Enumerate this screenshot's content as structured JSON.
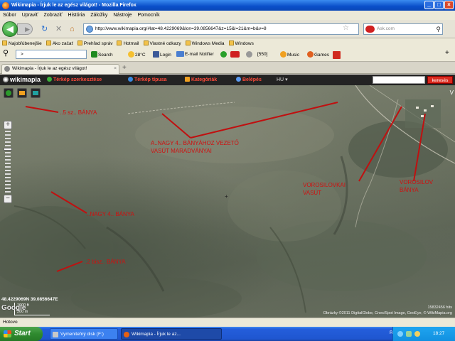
{
  "window": {
    "title": "Wikimapia - Írjuk le az egész világot! - Mozilla Firefox",
    "btn_min": "_",
    "btn_max": "□",
    "btn_close": "×"
  },
  "menu": [
    "Súbor",
    "Upraviť",
    "Zobraziť",
    "História",
    "Záložky",
    "Nástroje",
    "Pomocník"
  ],
  "nav": {
    "url": "http://www.wikimapia.org/#lat=48.4229069&lon=39.0856647&z=15&l=21&m=b&v=8",
    "search_placeholder": "Ask.com",
    "back_glyph": "◀",
    "forward_glyph": "▶",
    "reload_glyph": "↻",
    "stop_glyph": "✕",
    "home_glyph": "⌂",
    "star_glyph": "☆",
    "search_glyph": "⚲"
  },
  "bookmarks": [
    "Najobľúbenejšie",
    "Ako začať",
    "Prehľad správ",
    "Hotmail",
    "Vlastné odkazy",
    "Windows Media",
    "Windows"
  ],
  "toolbar2": {
    "search_value": ">",
    "search_label": "Search",
    "weather": "28°C",
    "facebook": "Login",
    "mail": "E-mail Notifier",
    "count": "[550]",
    "music": "Music",
    "games": "Games"
  },
  "tabs": [
    {
      "label": "Wikimapia - Írjuk le az egész világot!"
    }
  ],
  "newtab_glyph": "+",
  "wikimapia": {
    "logo": "wikimapia",
    "items": [
      "Térkép szerkesztése",
      "Térkép típusa",
      "Kategóriák",
      "Belépés"
    ],
    "lang": "HU",
    "search_button": "keresés"
  },
  "map": {
    "zoom_in": "+",
    "zoom_out": "−",
    "labels": [
      "..5 sz.. BÁNYA",
      "A..NAGY 4.. BÁNYÁHOZ VEZETŐ",
      "VASÚT MARADVÁNYAI",
      "VOROSILOVKAI",
      "VASÚT",
      "VOROSILOV",
      "BÁNYA",
      "..NAGY 4.. BÁNYA",
      "..2 bisz.. BÁNYA"
    ],
    "coords": "48.4229069N 39.0856647E",
    "google": "Google",
    "scale_top": "1000 ft",
    "scale_bottom": "200 m",
    "zoom_number": "15832456 hits",
    "attribution": "Obrázky ©2011 DigitalGlobe, Cnes/Spot Image, GeoEye, © WikiMapia.org",
    "right_edge": "V"
  },
  "status": "Hotovo",
  "taskbar": {
    "start": "Start",
    "tasks": [
      "Vymeniteľný disk (F:)",
      "Wikimapia - Írjuk le az..."
    ],
    "lang": "RU",
    "clock": "18:27"
  },
  "colors": {
    "label_red": "#d01010",
    "wm_red": "#ff4a3a",
    "wm_bar": "#232323"
  }
}
